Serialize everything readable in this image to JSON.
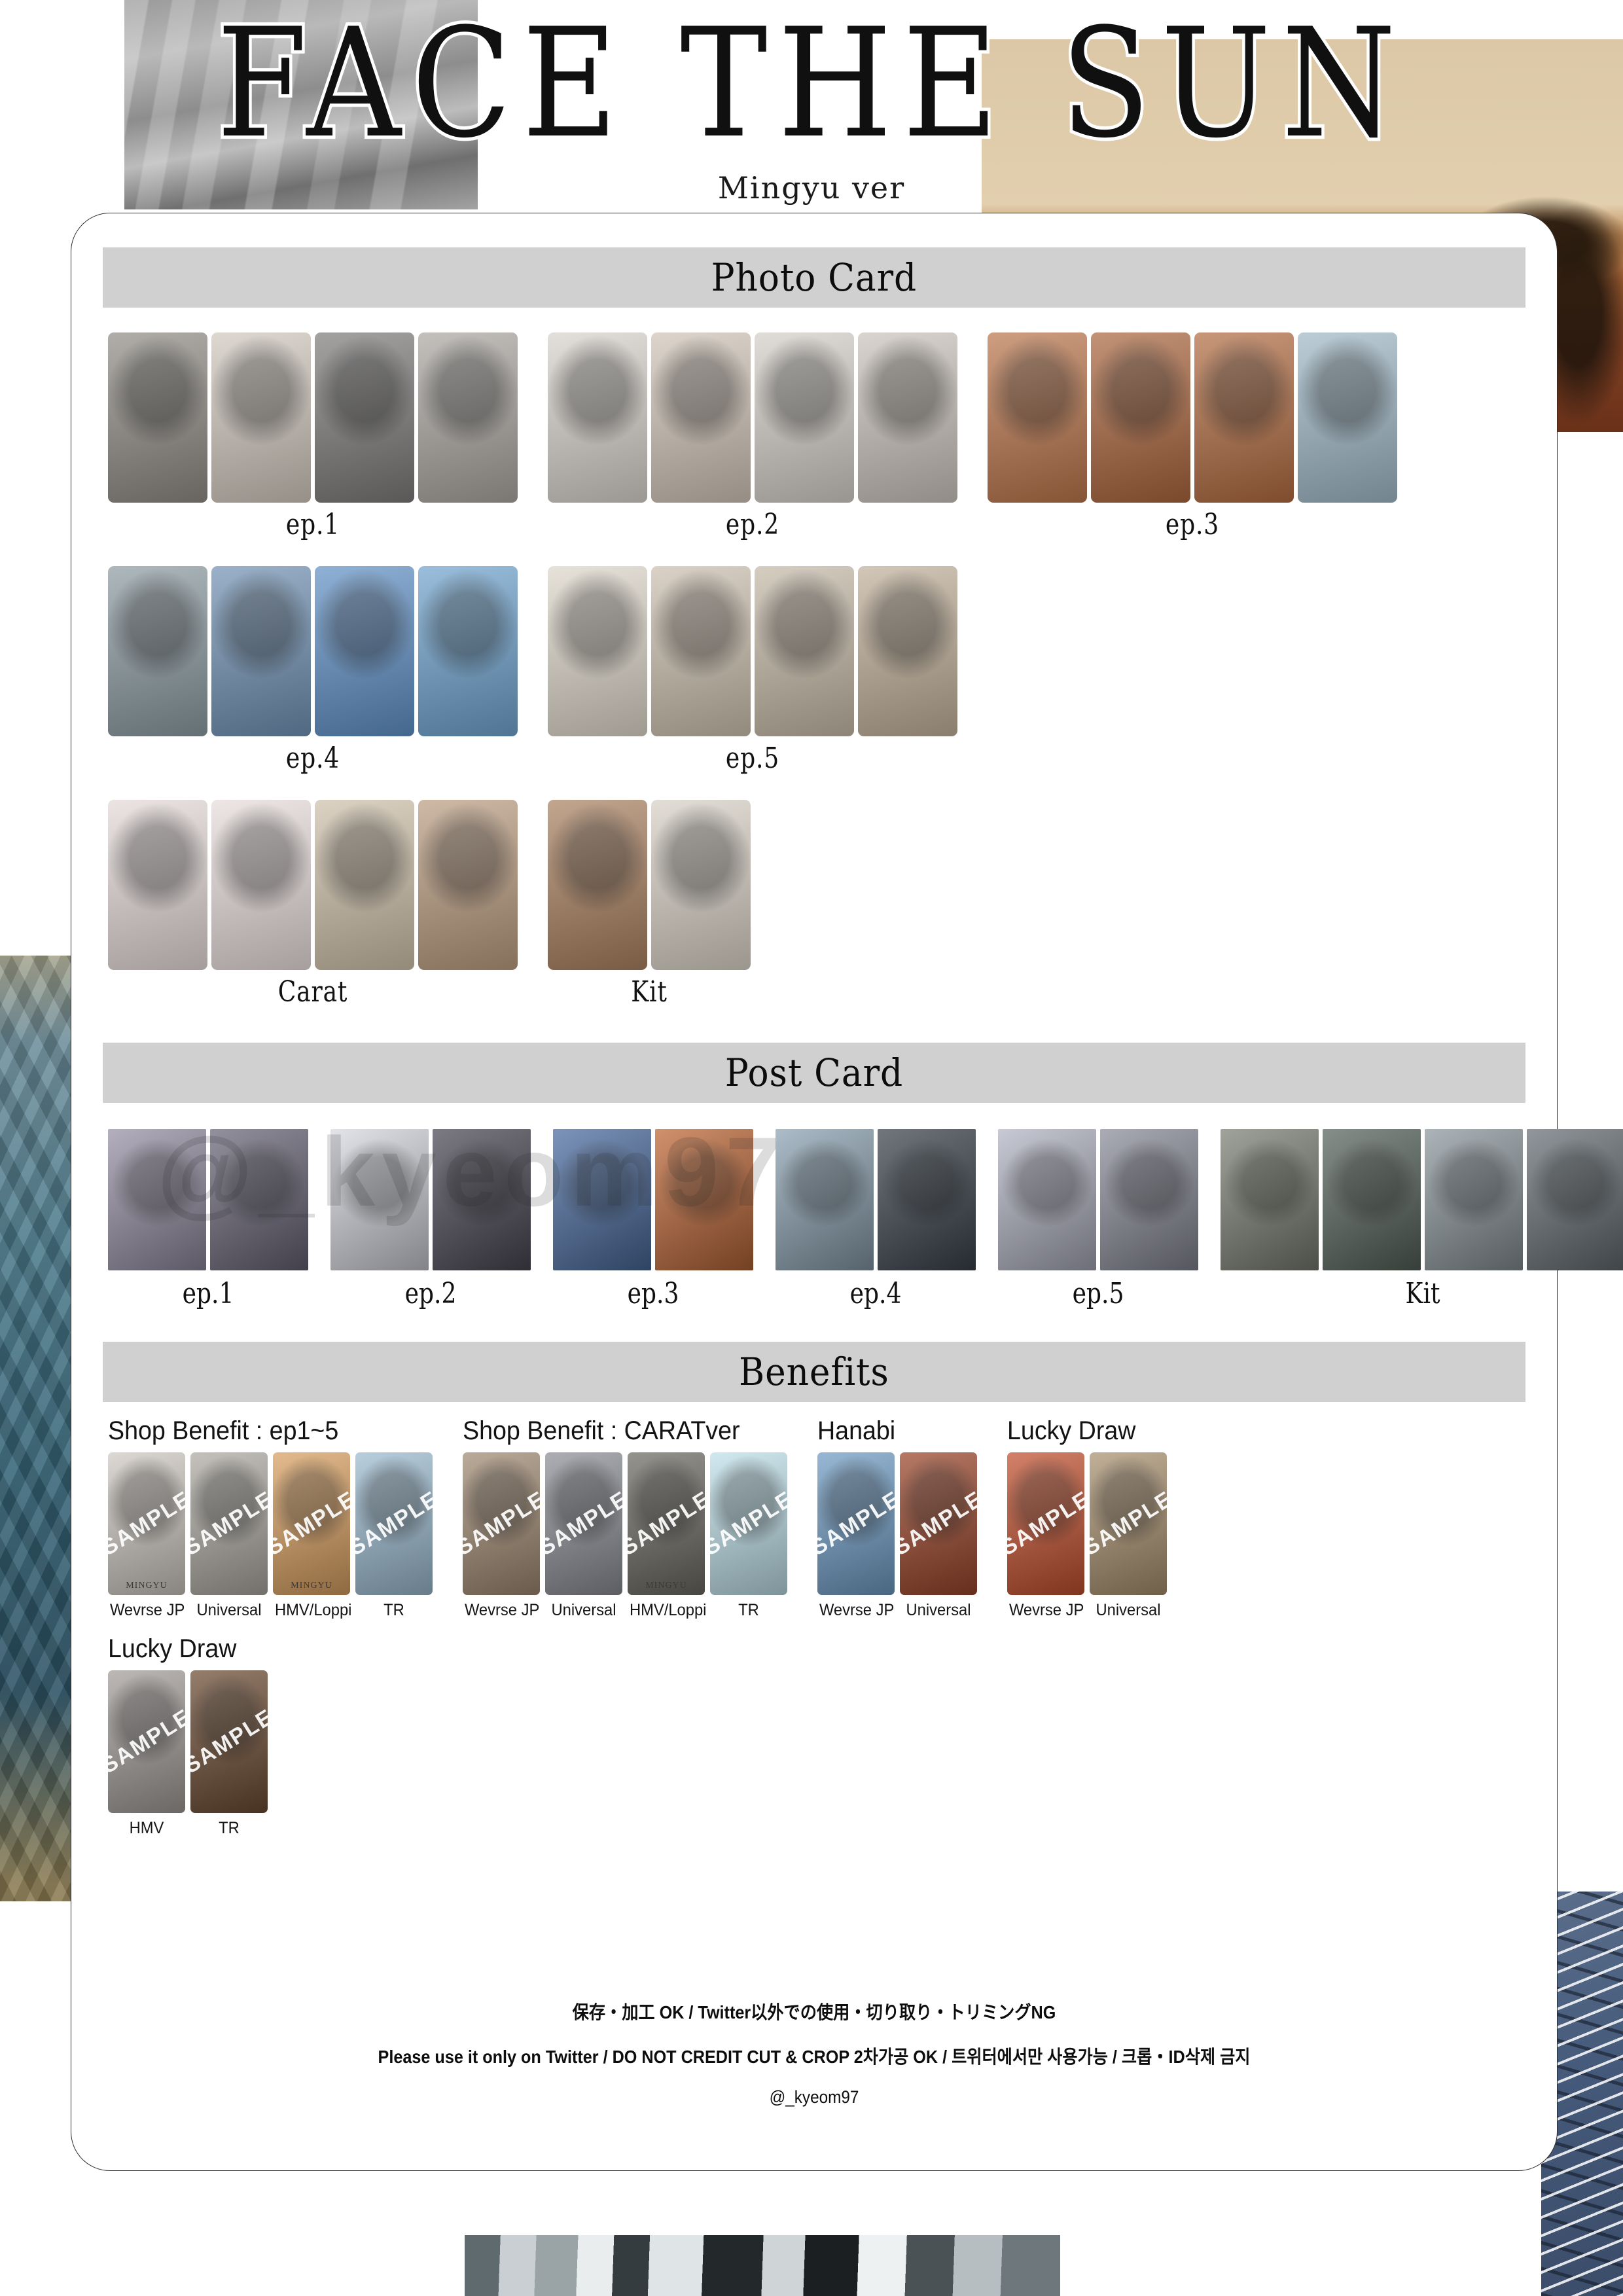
{
  "title": "FACE THE SUN",
  "subtitle": "Mingyu ver",
  "watermark": "@_kyeom97",
  "sections": {
    "photo_card": "Photo Card",
    "post_card": "Post Card",
    "benefits": "Benefits"
  },
  "photo_card_groups": [
    {
      "label": "ep.1",
      "count": 4,
      "swatches": [
        "#8f8b85",
        "#cfc7bd",
        "#7c7a79",
        "#a9a5a0"
      ]
    },
    {
      "label": "ep.2",
      "count": 4,
      "swatches": [
        "#d7d2cc",
        "#cfc3b6",
        "#d3cec8",
        "#c9c2ba"
      ]
    },
    {
      "label": "ep.3",
      "count": 4,
      "swatches": [
        "#b9744a",
        "#a9643c",
        "#b06a40",
        "#9fb7c6"
      ]
    },
    {
      "label": "ep.4",
      "count": 4,
      "swatches": [
        "#8b9aa0",
        "#6f90b2",
        "#5f8fc4",
        "#6ea2cd"
      ]
    },
    {
      "label": "ep.5",
      "count": 4,
      "swatches": [
        "#ddd6c9",
        "#cbbfae",
        "#c4b8a6",
        "#bfae98"
      ]
    },
    {
      "label": "Carat",
      "count": 4,
      "swatches": [
        "#e3d9d8",
        "#e6dcdb",
        "#cdbfa9",
        "#b99b7f"
      ]
    },
    {
      "label": "Kit",
      "count": 2,
      "swatches": [
        "#a87f5e",
        "#d6cfc4"
      ]
    }
  ],
  "post_card_groups": [
    {
      "label": "ep.1",
      "count": 2,
      "swatches": [
        "#9a93a8",
        "#6e6a7c"
      ]
    },
    {
      "label": "ep.2",
      "count": 2,
      "swatches": [
        "#d9dbe2",
        "#4e4c58"
      ]
    },
    {
      "label": "ep.3",
      "count": 2,
      "swatches": [
        "#4e6fa3",
        "#c06a3a"
      ]
    },
    {
      "label": "ep.4",
      "count": 2,
      "swatches": [
        "#8fa5b5",
        "#3f4750"
      ]
    },
    {
      "label": "ep.5",
      "count": 2,
      "swatches": [
        "#b5b7c6",
        "#8d8f9c"
      ]
    },
    {
      "label": "Kit",
      "count": 4,
      "swatches": [
        "#7f8377",
        "#5b6860",
        "#8f9aa0",
        "#6a7278"
      ]
    }
  ],
  "benefit_rows": [
    [
      {
        "title": "Shop Benefit : ep1~5",
        "sample_text": "SAMPLE",
        "items": [
          {
            "label": "Wevrse JP",
            "swatch": "#cfc9c2",
            "tag": "MINGYU"
          },
          {
            "label": "Universal",
            "swatch": "#aeaaa3",
            "tag": ""
          },
          {
            "label": "HMV/Loppi",
            "swatch": "#d9a061",
            "tag": "MINGYU"
          },
          {
            "label": "TR",
            "swatch": "#9dbcd1",
            "tag": ""
          }
        ]
      },
      {
        "title": "Shop Benefit : CARATver",
        "sample_text": "SAMPLE",
        "items": [
          {
            "label": "Wevrse JP",
            "swatch": "#a08a72",
            "tag": ""
          },
          {
            "label": "Universal",
            "swatch": "#8d8f96",
            "tag": ""
          },
          {
            "label": "HMV/Loppi",
            "swatch": "#6c6a63",
            "tag": "MINGYU"
          },
          {
            "label": "TR",
            "swatch": "#bfe0ea",
            "tag": ""
          }
        ]
      },
      {
        "title": "Hanabi",
        "sample_text": "SAMPLE",
        "items": [
          {
            "label": "Wevrse JP",
            "swatch": "#6f9cc4",
            "tag": ""
          },
          {
            "label": "Universal",
            "swatch": "#9a452a",
            "tag": ""
          }
        ]
      },
      {
        "title": "Lucky Draw",
        "sample_text": "SAMPLE",
        "items": [
          {
            "label": "Wevrse JP",
            "swatch": "#c2502f",
            "tag": ""
          },
          {
            "label": "Universal",
            "swatch": "#a9916f",
            "tag": ""
          }
        ]
      }
    ],
    [
      {
        "title": "Lucky Draw",
        "sample_text": "SAMPLE",
        "items": [
          {
            "label": "HMV",
            "swatch": "#a39d9a",
            "tag": ""
          },
          {
            "label": "TR",
            "swatch": "#6c4b32",
            "tag": ""
          }
        ]
      }
    ]
  ],
  "footer": {
    "line1": "保存・加工 OK / Twitter以外での使用・切り取り・トリミングNG",
    "line2": "Please use it only on Twitter / DO NOT CREDIT CUT & CROP   2차가공 OK / 트위터에서만 사용가능 / 크롭・ID삭제 금지",
    "line3": "@_kyeom97"
  },
  "colors": {
    "header_bar": "#d0d0d0",
    "panel_bg": "#ffffff",
    "text": "#111111"
  }
}
